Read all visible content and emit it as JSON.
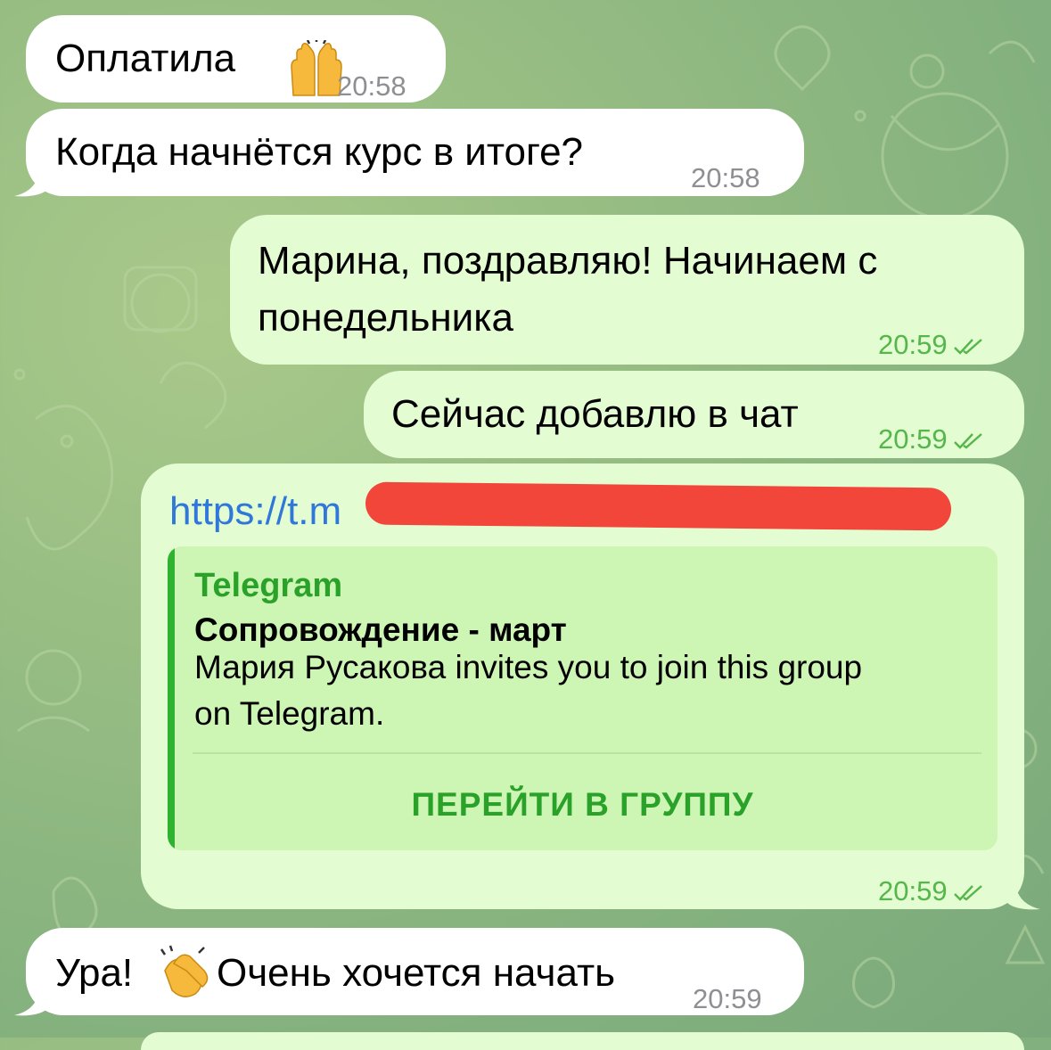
{
  "colors": {
    "incoming_bubble": "#ffffff",
    "outgoing_bubble": "#e4fcd2",
    "accent_green": "#2aa22a",
    "link_blue": "#2f77d9",
    "redaction": "#f2463a"
  },
  "messages": [
    {
      "text": "Оплатила",
      "emoji": "raising-hands",
      "time": "20:58",
      "direction": "in"
    },
    {
      "text": "Когда начнётся курс в итоге?",
      "time": "20:58",
      "direction": "in"
    },
    {
      "line1": "Марина, поздравляю! Начинаем с",
      "line2": "понедельника",
      "time": "20:59",
      "direction": "out",
      "status": "read"
    },
    {
      "text": "Сейчас добавлю в чат",
      "time": "20:59",
      "direction": "out",
      "status": "read"
    },
    {
      "direction": "out",
      "url_visible": "https://t.m",
      "time": "20:59",
      "status": "read",
      "preview": {
        "site": "Telegram",
        "title": "Сопровождение - март",
        "desc_line1": "Мария Русакова invites you to join this group",
        "desc_line2": "on Telegram.",
        "button": "ПЕРЕЙТИ В ГРУППУ"
      }
    },
    {
      "pre": "Ура! ",
      "emoji": "clapping-hands",
      "text": "Очень хочется начать",
      "time": "20:59",
      "direction": "in"
    }
  ]
}
